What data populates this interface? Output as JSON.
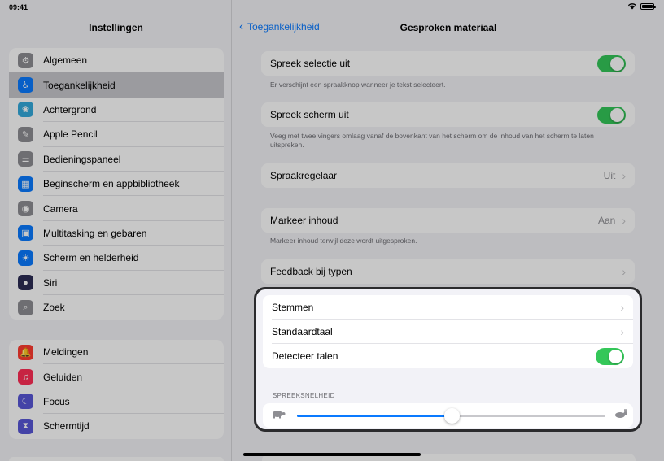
{
  "status": {
    "time": "09:41"
  },
  "sidebar": {
    "title": "Instellingen",
    "group1": [
      {
        "label": "Algemeen",
        "icon": "gear-icon",
        "color": "#8e8e93",
        "glyph": "⚙"
      },
      {
        "label": "Toegankelijkheid",
        "icon": "accessibility-icon",
        "color": "#0a7aff",
        "glyph": "♿",
        "active": true
      },
      {
        "label": "Achtergrond",
        "icon": "wallpaper-icon",
        "color": "#34aadc",
        "glyph": "❀"
      },
      {
        "label": "Apple Pencil",
        "icon": "pencil-icon",
        "color": "#8e8e93",
        "glyph": "✎"
      },
      {
        "label": "Bedieningspaneel",
        "icon": "control-center-icon",
        "color": "#8e8e93",
        "glyph": "⚌"
      },
      {
        "label": "Beginscherm en appbibliotheek",
        "icon": "home-screen-icon",
        "color": "#0a7aff",
        "glyph": "▦"
      },
      {
        "label": "Camera",
        "icon": "camera-icon",
        "color": "#8e8e93",
        "glyph": "◉"
      },
      {
        "label": "Multitasking en gebaren",
        "icon": "multitasking-icon",
        "color": "#0a7aff",
        "glyph": "▣"
      },
      {
        "label": "Scherm en helderheid",
        "icon": "brightness-icon",
        "color": "#0a7aff",
        "glyph": "☀"
      },
      {
        "label": "Siri",
        "icon": "siri-icon",
        "color": "#2c2c54",
        "glyph": "●"
      },
      {
        "label": "Zoek",
        "icon": "search-icon",
        "color": "#8e8e93",
        "glyph": "⌕"
      }
    ],
    "group2": [
      {
        "label": "Meldingen",
        "icon": "notifications-icon",
        "color": "#ff3b30",
        "glyph": "🔔"
      },
      {
        "label": "Geluiden",
        "icon": "sounds-icon",
        "color": "#ff2d55",
        "glyph": "♫"
      },
      {
        "label": "Focus",
        "icon": "moon-icon",
        "color": "#5856d6",
        "glyph": "☾"
      },
      {
        "label": "Schermtijd",
        "icon": "hourglass-icon",
        "color": "#5856d6",
        "glyph": "⧗"
      }
    ]
  },
  "nav": {
    "back_label": "Toegankelijkheid",
    "title": "Gesproken materiaal"
  },
  "main": {
    "speak_selection": {
      "label": "Spreek selectie uit",
      "on": true,
      "footnote": "Er verschijnt een spraakknop wanneer je tekst selecteert."
    },
    "speak_screen": {
      "label": "Spreek scherm uit",
      "on": true,
      "footnote": "Veeg met twee vingers omlaag vanaf de bovenkant van het scherm om de inhoud van het scherm te laten uitspreken."
    },
    "speech_controller": {
      "label": "Spraakregelaar",
      "value": "Uit"
    },
    "highlight_content": {
      "label": "Markeer inhoud",
      "value": "Aan",
      "footnote": "Markeer inhoud terwijl deze wordt uitgesproken."
    },
    "typing_feedback": {
      "label": "Feedback bij typen"
    },
    "voices": {
      "label": "Stemmen"
    },
    "default_language": {
      "label": "Standaardtaal"
    },
    "detect_languages": {
      "label": "Detecteer talen",
      "on": true
    },
    "speaking_rate": {
      "section_label": "SPREEKSNELHEID",
      "value": 0.5
    }
  },
  "colors": {
    "accent": "#0a7aff",
    "toggle_on": "#34c759"
  }
}
